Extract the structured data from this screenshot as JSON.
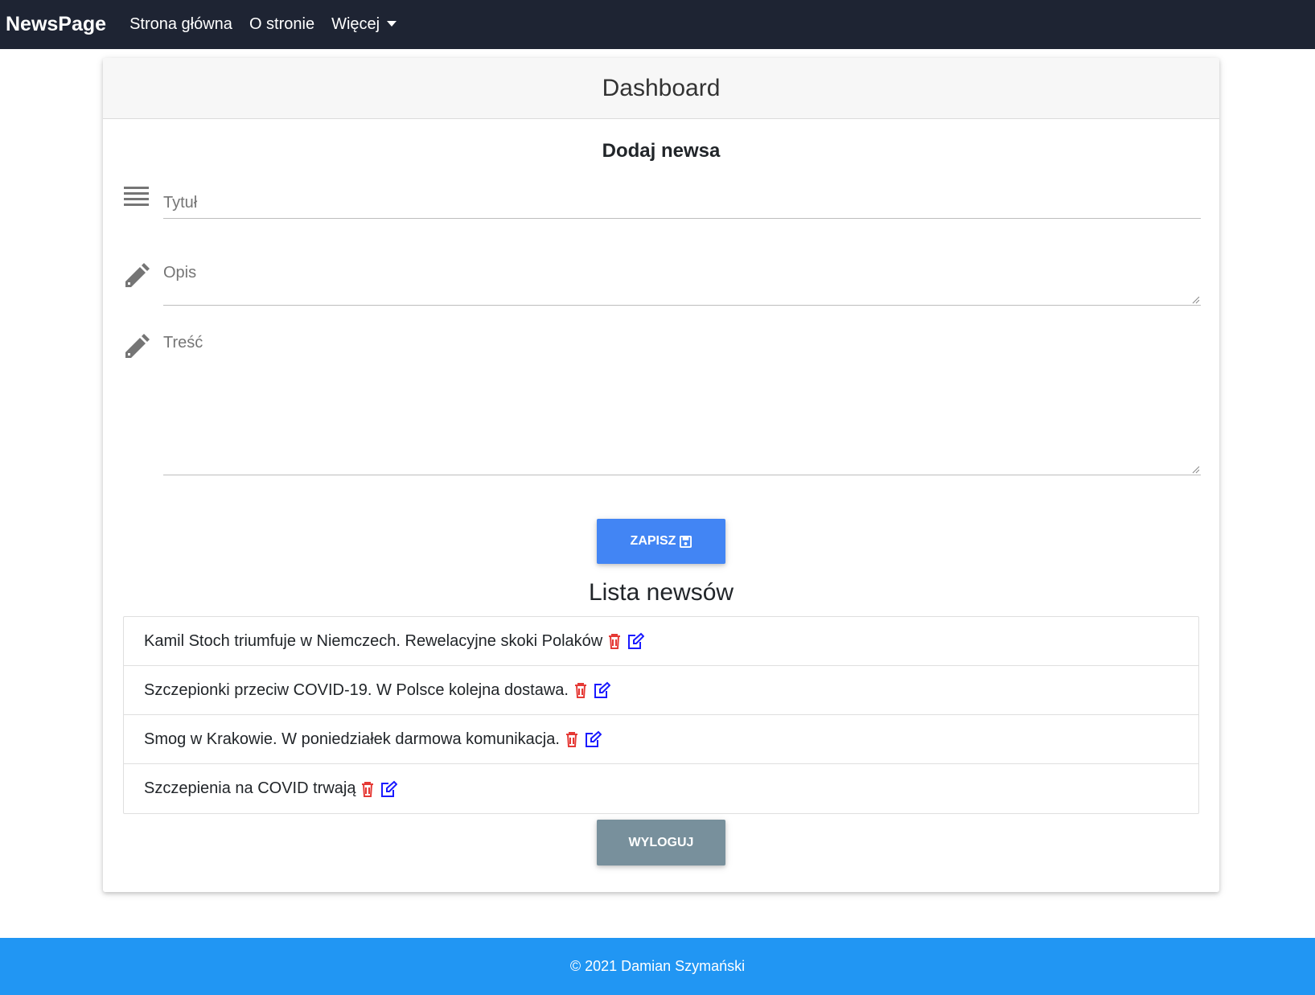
{
  "navbar": {
    "brand": "NewsPage",
    "links": [
      {
        "label": "Strona główna"
      },
      {
        "label": "O stronie"
      },
      {
        "label": "Więcej"
      }
    ]
  },
  "card": {
    "header": "Dashboard"
  },
  "form": {
    "title": "Dodaj newsa",
    "title_field": {
      "label": "Tytuł",
      "value": "",
      "icon": "list-icon"
    },
    "description_field": {
      "label": "Opis",
      "value": "",
      "icon": "pencil-icon"
    },
    "content_field": {
      "label": "Treść",
      "value": "",
      "icon": "pencil-icon"
    },
    "save_label": "ZAPISZ",
    "save_icon": "floppy-disk-icon"
  },
  "news_list": {
    "title": "Lista newsów",
    "items": [
      {
        "title": "Kamil Stoch triumfuje w Niemczech. Rewelacyjne skoki Polaków"
      },
      {
        "title": "Szczepionki przeciw COVID-19. W Polsce kolejna dostawa."
      },
      {
        "title": "Smog w Krakowie. W poniedziałek darmowa komunikacja."
      },
      {
        "title": "Szczepienia na COVID trwają"
      }
    ],
    "delete_icon": "trash-icon",
    "edit_icon": "edit-icon"
  },
  "logout_label": "WYLOGUJ",
  "footer": {
    "text": "© 2021 Damian Szymański"
  },
  "colors": {
    "navbar": "#1e2433",
    "primary": "#4285f4",
    "secondary": "#78909c",
    "footer": "#2196f3",
    "delete": "#e53935",
    "edit": "#1a1aff"
  }
}
